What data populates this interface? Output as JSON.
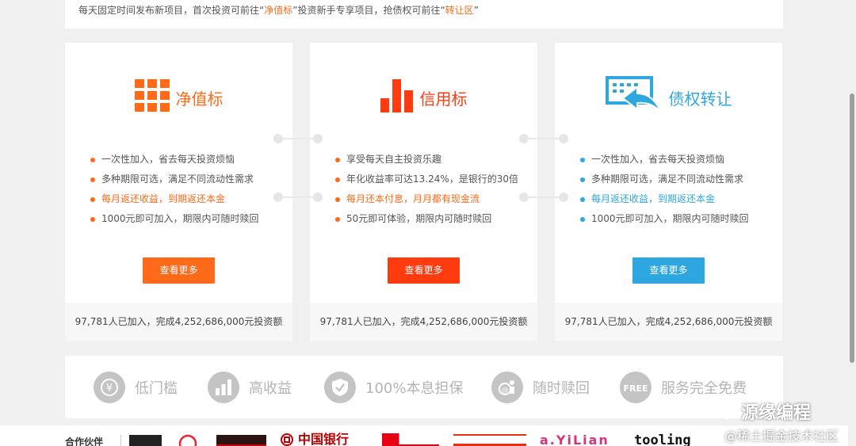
{
  "notice": {
    "text1": "每天固定时间发布新项目，首次投资可前往“",
    "link1": "净值标",
    "text2": "”投资新手专享项目，抢债权可前往“",
    "link2": "转让区",
    "text3": "”"
  },
  "cards": [
    {
      "title": "净值标",
      "icon": "grid-icon",
      "color": "#ff6a1a",
      "items": [
        "一次性加入，省去每天投资烦恼",
        "多种期限可选，满足不同流动性需求",
        "每月返还收益，到期返还本金",
        "1000元即可加入，期限内可随时赎回"
      ],
      "highlight_index": 2,
      "button": "查看更多",
      "footer": "97,781人已加入，完成4,252,686,000元投资额"
    },
    {
      "title": "信用标",
      "icon": "bar-chart-icon",
      "color": "#ff3b0f",
      "items": [
        "享受每天自主投资乐趣",
        "年化收益率可达13.24%，是银行的30倍",
        "每月还本付息，月月都有现金流",
        "50元即可体验，期限内可随时赎回"
      ],
      "highlight_index": 2,
      "button": "查看更多",
      "footer": "97,781人已加入，完成4,252,686,000元投资额"
    },
    {
      "title": "债权转让",
      "icon": "transfer-icon",
      "color": "#2ea7e0",
      "items": [
        "一次性加入，省去每天投资烦恼",
        "多种期限可选，满足不同流动性需求",
        "每月返还收益，到期返还本金",
        "1000元即可加入，期限内可随时赎回"
      ],
      "highlight_index": 2,
      "button": "查看更多",
      "footer": "97,781人已加入，完成4,252,686,000元投资额"
    }
  ],
  "features": [
    {
      "label": "低门槛",
      "icon": "yen-cycle-icon"
    },
    {
      "label": "高收益",
      "icon": "bar-chart-icon"
    },
    {
      "label": "100%本息担保",
      "icon": "shield-check-icon"
    },
    {
      "label": "随时赎回",
      "icon": "redeem-icon"
    },
    {
      "label": "服务完全免费",
      "icon": "free-badge-icon"
    }
  ],
  "partners": {
    "label": "合作伙伴",
    "logos": [
      "中国银行",
      "a.YiLian",
      "tooling"
    ]
  },
  "watermark": {
    "main": "源缘编程",
    "sub": "@稀土掘金技术社区"
  },
  "colors": {
    "orange": "#ff6a1a",
    "red": "#ff3b0f",
    "blue": "#2ea7e0"
  }
}
